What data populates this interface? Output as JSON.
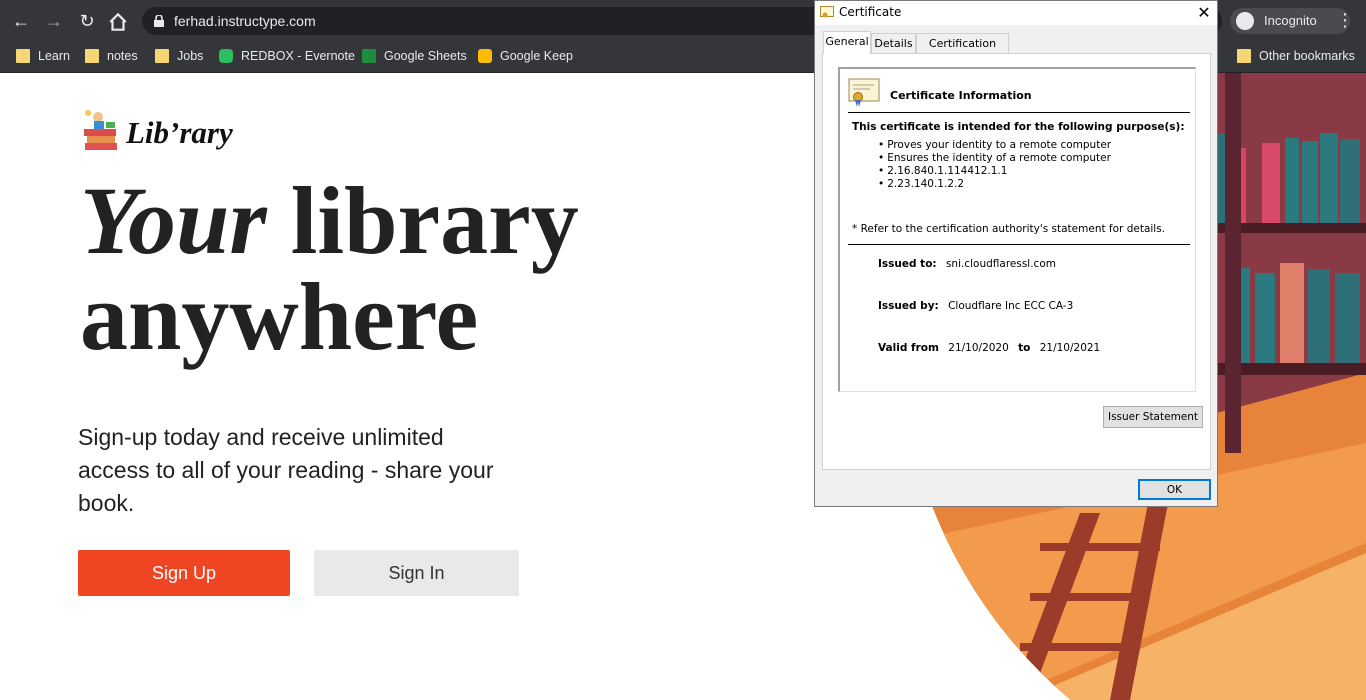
{
  "browser": {
    "url": "ferhad.instructype.com",
    "incognito_label": "Incognito",
    "bookmarks": [
      {
        "label": "Learn",
        "icon": "folder-icon"
      },
      {
        "label": "notes",
        "icon": "folder-icon"
      },
      {
        "label": "Jobs",
        "icon": "folder-icon"
      },
      {
        "label": "REDBOX - Evernote",
        "icon": "evernote-icon"
      },
      {
        "label": "Google Sheets",
        "icon": "sheets-icon"
      },
      {
        "label": "Google Keep",
        "icon": "keep-icon"
      }
    ],
    "other_bookmarks": "Other bookmarks"
  },
  "page": {
    "logo_text": "Lib’rary",
    "hero_italic": "Your",
    "hero_rest": "library",
    "hero_line2": "anywhere",
    "subtitle": "Sign-up today and receive unlimited access to all of your reading - share your book.",
    "signup_label": "Sign Up",
    "signin_label": "Sign In",
    "colors": {
      "accent": "#ef4523",
      "signin_bg": "#e9e9e9"
    }
  },
  "dialog": {
    "title": "Certificate",
    "tabs": [
      "General",
      "Details",
      "Certification Path"
    ],
    "info_heading": "Certificate Information",
    "purpose_heading": "This certificate is intended for the following purpose(s):",
    "purposes": [
      "Proves your identity to a remote computer",
      "Ensures the identity of a remote computer",
      "2.16.840.1.114412.1.1",
      "2.23.140.1.2.2"
    ],
    "note": "* Refer to the certification authority's statement for details.",
    "issued_to_label": "Issued to:",
    "issued_to": "sni.cloudflaressl.com",
    "issued_by_label": "Issued by:",
    "issued_by": "Cloudflare Inc ECC CA-3",
    "valid_from_label": "Valid from",
    "valid_from": "21/10/2020",
    "to_label": "to",
    "valid_to": "21/10/2021",
    "issuer_statement": "Issuer Statement",
    "ok": "OK"
  }
}
